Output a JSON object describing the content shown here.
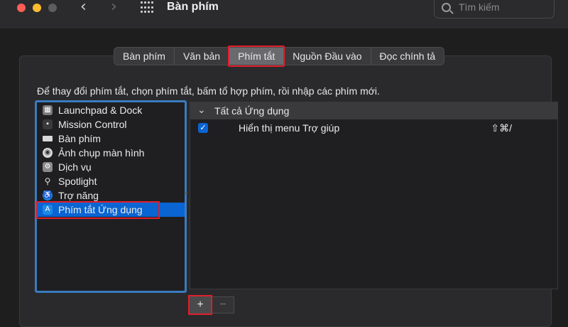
{
  "window": {
    "title": "Bàn phím",
    "search_placeholder": "Tìm kiếm"
  },
  "tabs": [
    {
      "label": "Bàn phím",
      "active": false
    },
    {
      "label": "Văn bản",
      "active": false
    },
    {
      "label": "Phím tắt",
      "active": true
    },
    {
      "label": "Nguồn Đầu vào",
      "active": false
    },
    {
      "label": "Đọc chính tả",
      "active": false
    }
  ],
  "instruction": "Để thay đổi phím tắt, chọn phím tắt, bấm tổ hợp phím, rồi nhập các phím mới.",
  "categories": [
    {
      "label": "Launchpad & Dock",
      "icon": "launchpad-icon",
      "color": "#7a7a7a"
    },
    {
      "label": "Mission Control",
      "icon": "mission-control-icon",
      "color": "#3a3a3a"
    },
    {
      "label": "Bàn phím",
      "icon": "keyboard-icon",
      "color": "#d8d8d8"
    },
    {
      "label": "Ảnh chụp màn hình",
      "icon": "screenshot-icon",
      "color": "#d8d8d8"
    },
    {
      "label": "Dịch vụ",
      "icon": "gear-icon",
      "color": "#8a8a8a"
    },
    {
      "label": "Spotlight",
      "icon": "search-icon",
      "color": "#1f1f21"
    },
    {
      "label": "Trợ năng",
      "icon": "accessibility-icon",
      "color": "#1e88e5"
    },
    {
      "label": "Phím tắt Ứng dụng",
      "icon": "app-store-icon",
      "color": "#1e88e5",
      "selected": true
    }
  ],
  "shortcuts": {
    "group_label": "Tất cả Ứng dụng",
    "rows": [
      {
        "name": "Hiển thị menu Trợ giúp",
        "keys": "⇧⌘/",
        "checked": true
      }
    ]
  },
  "buttons": {
    "add": "+",
    "remove": "−"
  },
  "colors": {
    "accent": "#0a64d2",
    "highlight": "#e01e2b",
    "list_border": "#3a7bbf"
  }
}
